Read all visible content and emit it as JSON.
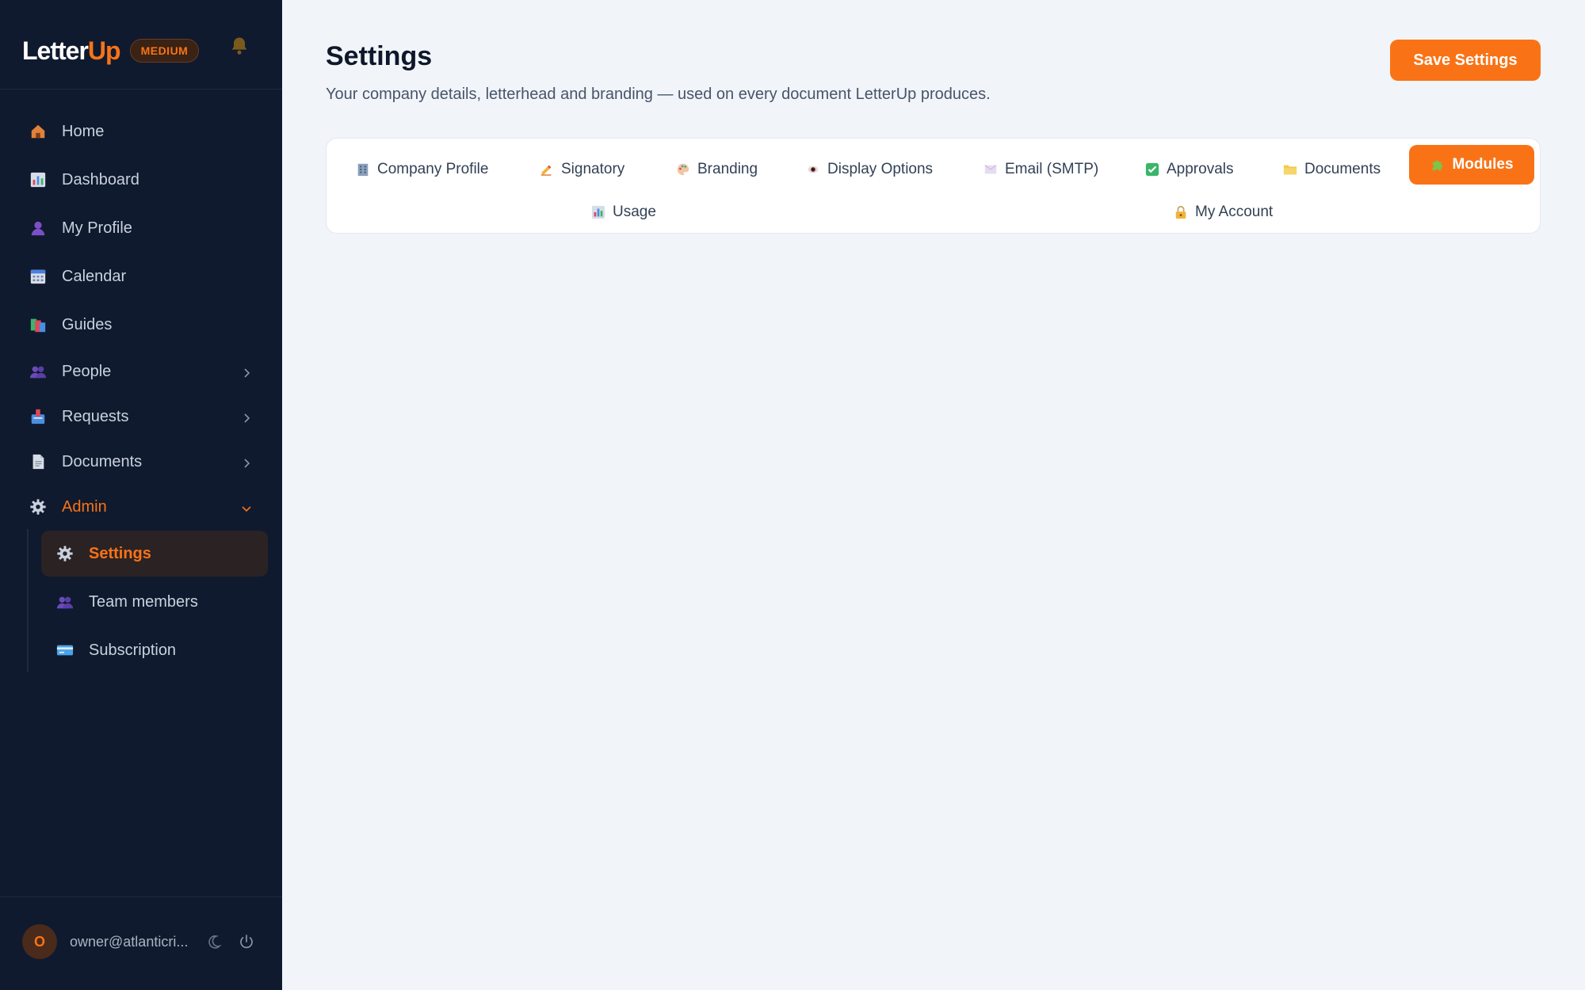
{
  "brand": {
    "name_main": "Letter",
    "name_accent": "Up",
    "plan_badge": "MEDIUM"
  },
  "sidebar": {
    "items": [
      {
        "label": "Home",
        "icon": "home-icon"
      },
      {
        "label": "Dashboard",
        "icon": "dashboard-icon"
      },
      {
        "label": "My Profile",
        "icon": "profile-icon"
      },
      {
        "label": "Calendar",
        "icon": "calendar-icon"
      },
      {
        "label": "Guides",
        "icon": "guides-icon"
      },
      {
        "label": "People",
        "icon": "people-icon"
      },
      {
        "label": "Requests",
        "icon": "requests-icon"
      },
      {
        "label": "Documents",
        "icon": "documents-icon"
      },
      {
        "label": "Admin",
        "icon": "gear-icon"
      }
    ],
    "admin_sub": [
      {
        "label": "Settings",
        "icon": "gear-icon",
        "active": true
      },
      {
        "label": "Team members",
        "icon": "team-icon"
      },
      {
        "label": "Subscription",
        "icon": "credit-card-icon"
      }
    ]
  },
  "user": {
    "initial": "O",
    "email": "owner@atlanticri..."
  },
  "header": {
    "title": "Settings",
    "subtitle": "Your company details, letterhead and branding — used on every document LetterUp produces.",
    "save_label": "Save Settings"
  },
  "tabs": [
    {
      "label": "Company Profile",
      "icon": "building-icon"
    },
    {
      "label": "Signatory",
      "icon": "writing-hand-icon"
    },
    {
      "label": "Branding",
      "icon": "palette-icon"
    },
    {
      "label": "Display Options",
      "icon": "eye-icon"
    },
    {
      "label": "Email (SMTP)",
      "icon": "envelope-icon"
    },
    {
      "label": "Approvals",
      "icon": "checkmark-icon"
    },
    {
      "label": "Documents",
      "icon": "folder-icon"
    },
    {
      "label": "Modules",
      "icon": "puzzle-icon",
      "active": true
    },
    {
      "label": "Usage",
      "icon": "bar-chart-icon"
    },
    {
      "label": "My Account",
      "icon": "lock-icon"
    }
  ],
  "colors": {
    "accent": "#f97316",
    "sidebar_bg": "#101a2e",
    "page_bg": "#f1f4f9"
  }
}
